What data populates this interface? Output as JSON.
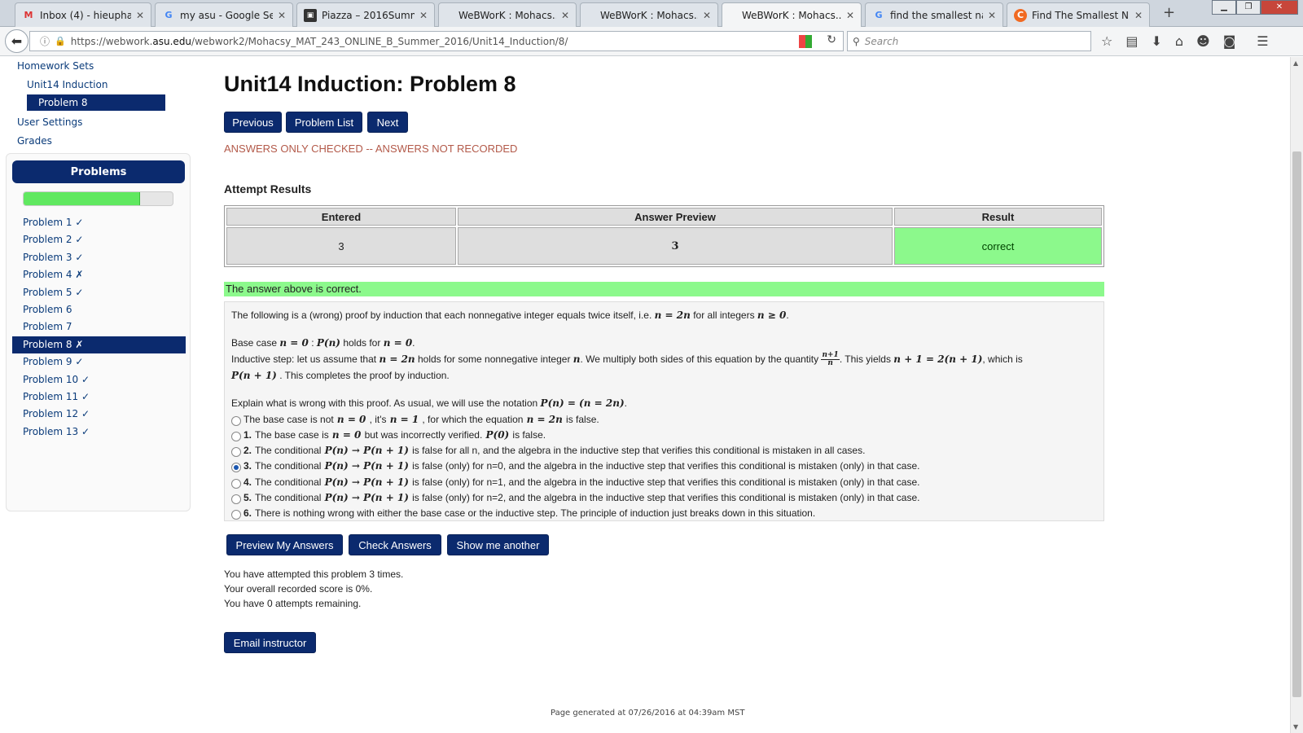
{
  "browser": {
    "tabs": [
      {
        "title": "Inbox (4) - hieupha...",
        "icon": "gmail-icon",
        "active": false
      },
      {
        "title": "my asu - Google Sea...",
        "icon": "google-icon",
        "active": false
      },
      {
        "title": "Piazza – 2016Summ...",
        "icon": "piazza-icon",
        "active": false
      },
      {
        "title": "WeBWorK : Mohacs...",
        "icon": "",
        "active": false
      },
      {
        "title": "WeBWorK : Mohacs...",
        "icon": "",
        "active": false
      },
      {
        "title": "WeBWorK : Mohacs...",
        "icon": "",
        "active": true
      },
      {
        "title": "find the smallest nat...",
        "icon": "google-icon",
        "active": false
      },
      {
        "title": "Find The Smallest N...",
        "icon": "chegg-icon",
        "active": false
      }
    ],
    "url_prefix": "https://webwork.",
    "url_host": "asu.edu",
    "url_path": "/webwork2/Mohacsy_MAT_243_ONLINE_B_Summer_2016/Unit14_Induction/8/",
    "search_placeholder": "Search"
  },
  "sidebar": {
    "homework_sets": "Homework Sets",
    "unit": "Unit14 Induction",
    "current_problem": "Problem 8",
    "user_settings": "User Settings",
    "grades": "Grades",
    "problems_header": "Problems",
    "progress_fraction": 0.78,
    "problems": [
      {
        "label": "Problem 1 ✓"
      },
      {
        "label": "Problem 2 ✓"
      },
      {
        "label": "Problem 3 ✓"
      },
      {
        "label": "Problem 4 ✗"
      },
      {
        "label": "Problem 5 ✓"
      },
      {
        "label": "Problem 6"
      },
      {
        "label": "Problem 7"
      },
      {
        "label": "Problem 8 ✗",
        "active": true
      },
      {
        "label": "Problem 9 ✓"
      },
      {
        "label": "Problem 10 ✓"
      },
      {
        "label": "Problem 11 ✓"
      },
      {
        "label": "Problem 12 ✓"
      },
      {
        "label": "Problem 13 ✓"
      }
    ]
  },
  "main": {
    "title": "Unit14 Induction: Problem 8",
    "btn_previous": "Previous",
    "btn_problem_list": "Problem List",
    "btn_next": "Next",
    "notice": "ANSWERS ONLY CHECKED -- ANSWERS NOT RECORDED",
    "attempt_heading": "Attempt Results",
    "table": {
      "headers": [
        "Entered",
        "Answer Preview",
        "Result"
      ],
      "row": [
        "3",
        "3",
        "correct"
      ]
    },
    "correct_message": "The answer above is correct.",
    "problem": {
      "intro": "The following is a (wrong) proof by induction that each nonnegative integer equals twice itself, i.e.",
      "explain": "Explain what is wrong with this proof. As usual, we will use the notation"
    },
    "btn_preview": "Preview My Answers",
    "btn_check": "Check Answers",
    "btn_another": "Show me another",
    "status_lines": [
      "You have attempted this problem 3 times.",
      "Your overall recorded score is 0%.",
      "You have 0 attempts remaining."
    ],
    "btn_email": "Email instructor",
    "footer": "Page generated at 07/26/2016 at 04:39am MST"
  },
  "colors": {
    "navy": "#0b2a6e",
    "correct_green": "#8cf98c",
    "notice_red": "#b35a4a"
  }
}
